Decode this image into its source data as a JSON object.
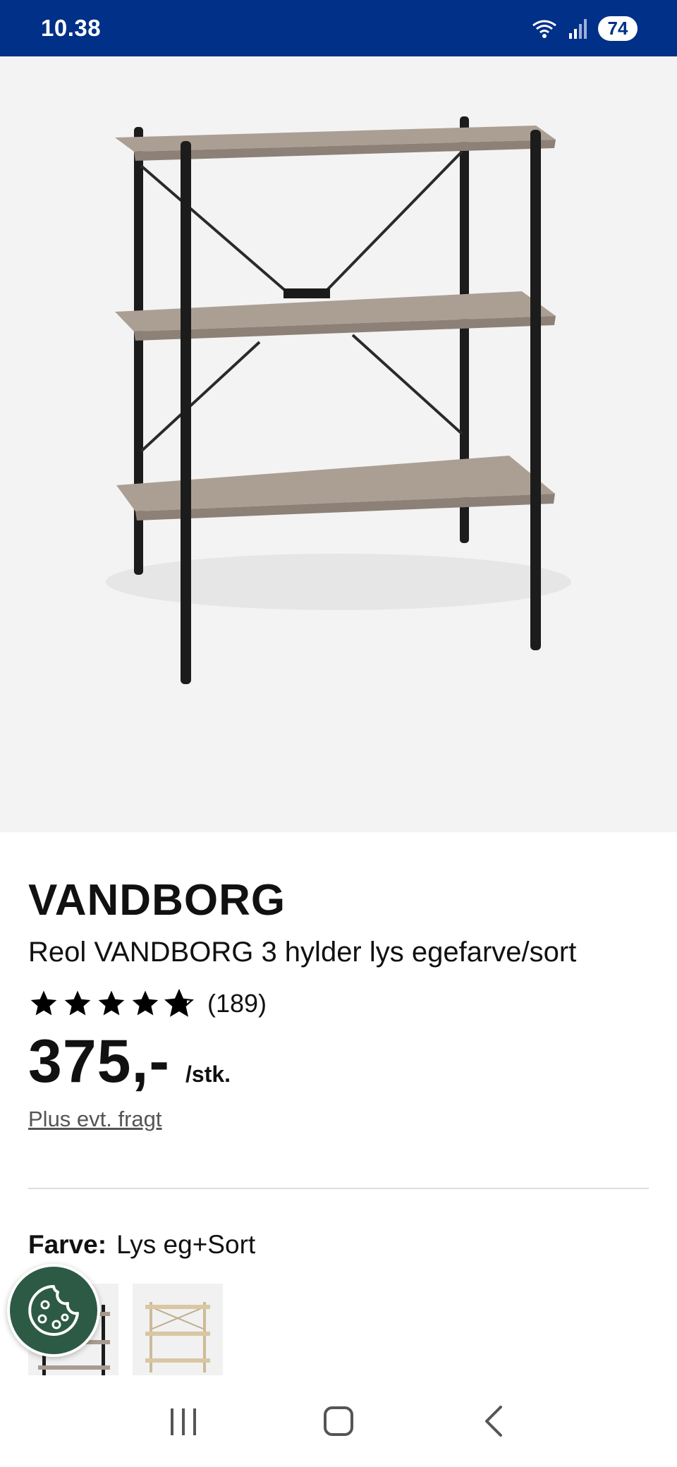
{
  "status": {
    "time": "10.38",
    "battery": "74"
  },
  "product": {
    "brand": "VANDBORG",
    "name": "Reol VANDBORG 3 hylder lys egefarve/sort",
    "rating": 4.8,
    "review_count": "(189)",
    "price": "375,-",
    "unit": "/stk.",
    "shipping": "Plus evt. fragt"
  },
  "color": {
    "label": "Farve:",
    "value": "Lys eg+Sort"
  },
  "colors": {
    "status_bar": "#003087",
    "cookie_button": "#2d5a45"
  },
  "icons": {
    "cookie": "cookie-icon",
    "recents": "recents-icon",
    "home": "home-icon",
    "back": "back-icon"
  }
}
